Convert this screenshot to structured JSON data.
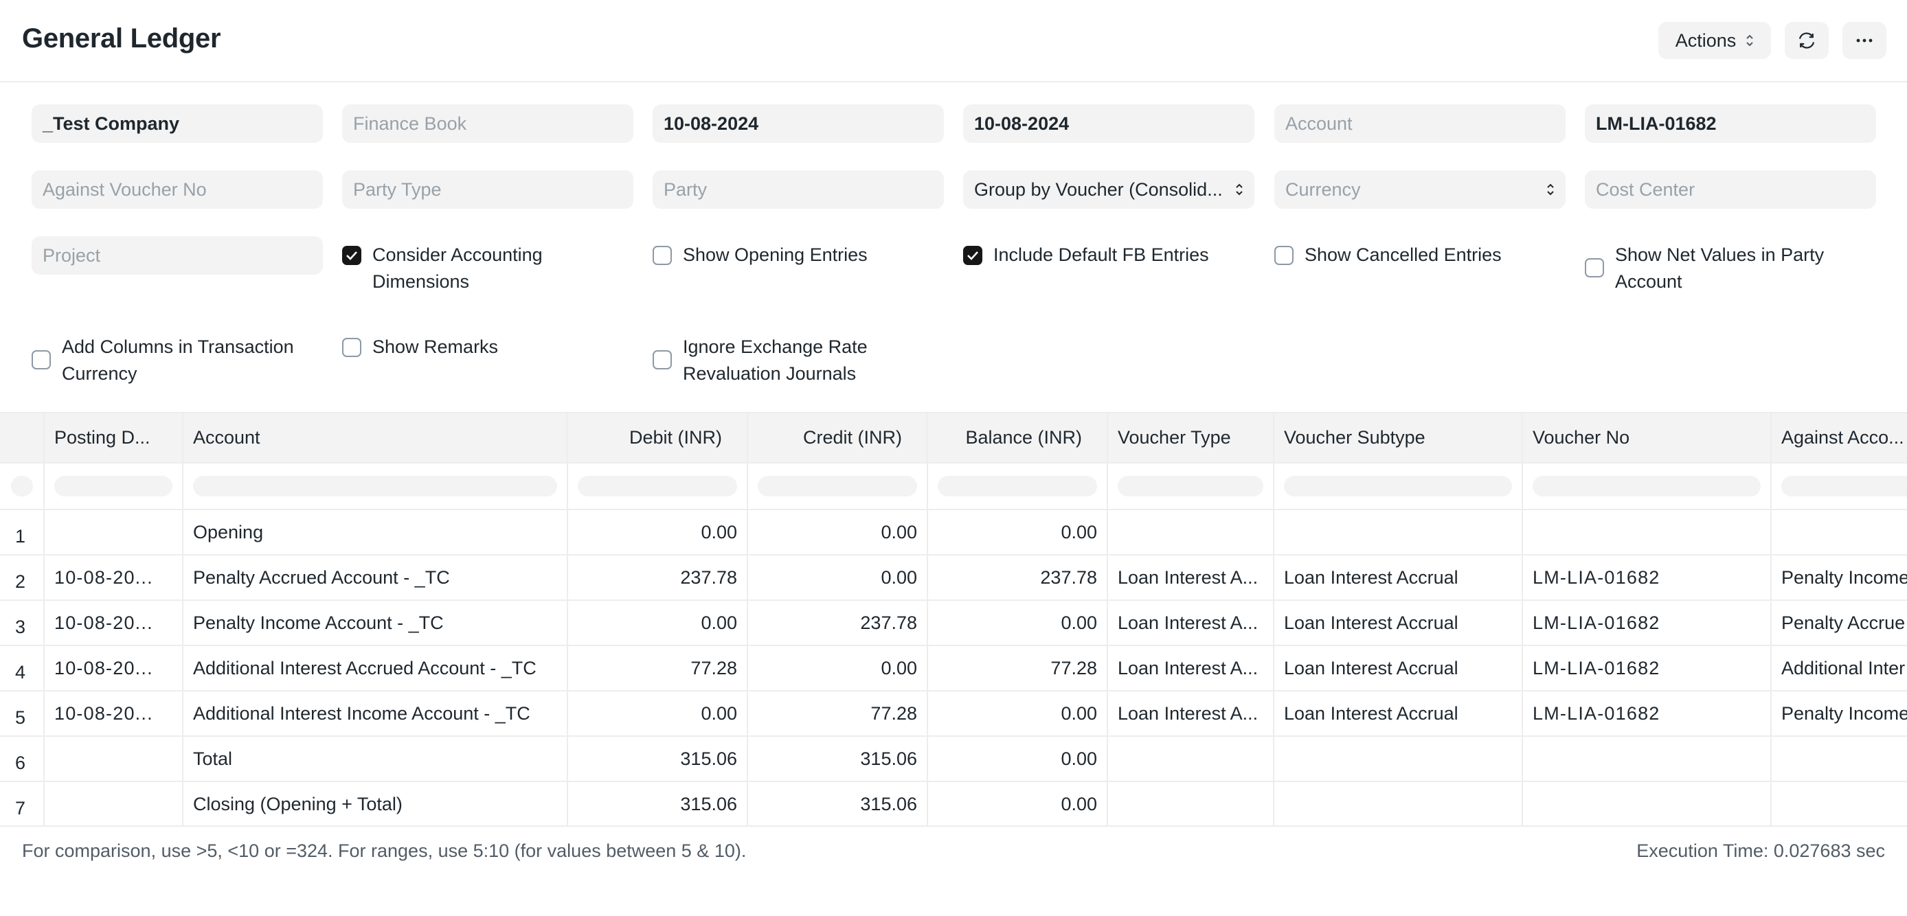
{
  "header": {
    "title": "General Ledger",
    "actions_label": "Actions"
  },
  "filters": {
    "company": "_Test Company",
    "finance_book": {
      "placeholder": "Finance Book"
    },
    "from_date": "10-08-2024",
    "to_date": "10-08-2024",
    "account": {
      "placeholder": "Account"
    },
    "voucher_no": "LM-LIA-01682",
    "against_voucher_no": {
      "placeholder": "Against Voucher No"
    },
    "party_type": {
      "placeholder": "Party Type"
    },
    "party": {
      "placeholder": "Party"
    },
    "group_by": "Group by Voucher (Consolid...",
    "currency": {
      "placeholder": "Currency"
    },
    "cost_center": {
      "placeholder": "Cost Center"
    },
    "project": {
      "placeholder": "Project"
    }
  },
  "checkboxes": [
    {
      "label_1": "Consider Accounting",
      "label_2": "Dimensions",
      "checked": true
    },
    {
      "label_1": "Show Opening Entries",
      "checked": false
    },
    {
      "label_1": "Include Default FB Entries",
      "checked": true
    },
    {
      "label_1": "Show Cancelled Entries",
      "checked": false
    },
    {
      "label_1": "Show Net Values in Party",
      "label_2": "Account",
      "checked": false
    },
    {
      "label_1": "Add Columns in Transaction",
      "label_2": "Currency",
      "checked": false
    },
    {
      "label_1": "Show Remarks",
      "checked": false
    },
    {
      "label_1": "Ignore Exchange Rate",
      "label_2": "Revaluation Journals",
      "checked": false
    }
  ],
  "table": {
    "columns": [
      "Posting D...",
      "Account",
      "Debit (INR)",
      "Credit (INR)",
      "Balance (INR)",
      "Voucher Type",
      "Voucher Subtype",
      "Voucher No",
      "Against Acco..."
    ],
    "rows": [
      {
        "idx": "1",
        "posting_date": "",
        "account": "Opening",
        "debit": "0.00",
        "credit": "0.00",
        "balance": "0.00",
        "voucher_type": "",
        "voucher_subtype": "",
        "voucher_no": "",
        "against": ""
      },
      {
        "idx": "2",
        "posting_date": "10-08-20...",
        "account": "Penalty Accrued Account - _TC",
        "debit": "237.78",
        "credit": "0.00",
        "balance": "237.78",
        "voucher_type": "Loan Interest A...",
        "voucher_subtype": "Loan Interest Accrual",
        "voucher_no": "LM-LIA-01682",
        "against": "Penalty Income"
      },
      {
        "idx": "3",
        "posting_date": "10-08-20...",
        "account": "Penalty Income Account - _TC",
        "debit": "0.00",
        "credit": "237.78",
        "balance": "0.00",
        "voucher_type": "Loan Interest A...",
        "voucher_subtype": "Loan Interest Accrual",
        "voucher_no": "LM-LIA-01682",
        "against": "Penalty Accrue"
      },
      {
        "idx": "4",
        "posting_date": "10-08-20...",
        "account": "Additional Interest Accrued Account - _TC",
        "debit": "77.28",
        "credit": "0.00",
        "balance": "77.28",
        "voucher_type": "Loan Interest A...",
        "voucher_subtype": "Loan Interest Accrual",
        "voucher_no": "LM-LIA-01682",
        "against": "Additional Inter"
      },
      {
        "idx": "5",
        "posting_date": "10-08-20...",
        "account": "Additional Interest Income Account - _TC",
        "debit": "0.00",
        "credit": "77.28",
        "balance": "0.00",
        "voucher_type": "Loan Interest A...",
        "voucher_subtype": "Loan Interest Accrual",
        "voucher_no": "LM-LIA-01682",
        "against": "Penalty Income"
      },
      {
        "idx": "6",
        "posting_date": "",
        "account": "Total",
        "debit": "315.06",
        "credit": "315.06",
        "balance": "0.00",
        "voucher_type": "",
        "voucher_subtype": "",
        "voucher_no": "",
        "against": ""
      },
      {
        "idx": "7",
        "posting_date": "",
        "account": "Closing (Opening + Total)",
        "debit": "315.06",
        "credit": "315.06",
        "balance": "0.00",
        "voucher_type": "",
        "voucher_subtype": "",
        "voucher_no": "",
        "against": ""
      }
    ]
  },
  "footer": {
    "hint": "For comparison, use >5, <10 or =324. For ranges, use 5:10 (for values between 5 & 10).",
    "execution_time": "Execution Time: 0.027683 sec"
  }
}
